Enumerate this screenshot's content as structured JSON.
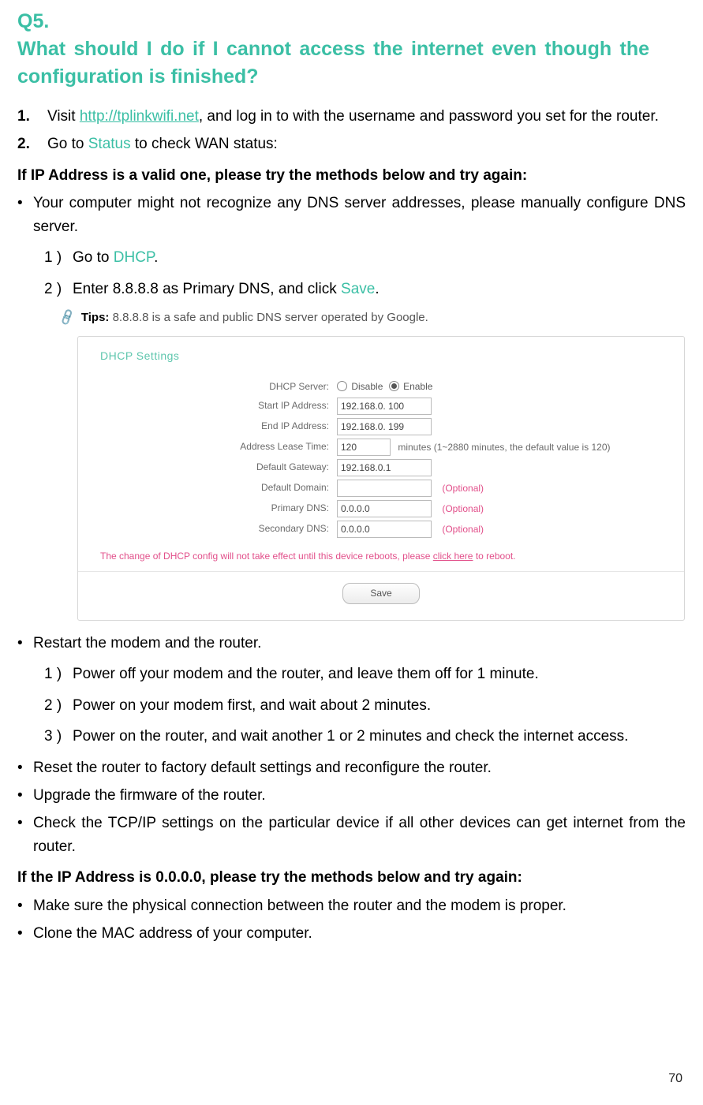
{
  "pageNumber": "70",
  "question": {
    "label": "Q5.",
    "text": "What should I do if I cannot access the internet even though the configuration is finished?"
  },
  "steps": {
    "s1": {
      "marker": "1.",
      "prefix": "Visit ",
      "link": "http://tplinkwifi.net",
      "suffix": ", and log in to with the username and password you set for the router."
    },
    "s2": {
      "marker": "2.",
      "prefix": "Go to ",
      "green": "Status",
      "suffix": " to check WAN status:"
    }
  },
  "validIpHeader": "If IP Address is a valid one, please try the methods below and try again:",
  "bullets1": {
    "b1": "Your computer might not recognize any DNS server addresses, please manually configure DNS server."
  },
  "sub1": {
    "n1": {
      "marker": "1 )",
      "prefix": "Go to ",
      "green": "DHCP",
      "suffix": "."
    },
    "n2": {
      "marker": "2 )",
      "prefix": "Enter 8.8.8.8 as Primary DNS, and click ",
      "green": "Save",
      "suffix": "."
    }
  },
  "tips": {
    "label": "Tips:",
    "text": " 8.8.8.8 is a safe and public DNS server operated by Google."
  },
  "figure": {
    "title": "DHCP Settings",
    "rows": {
      "server": {
        "label": "DHCP Server:",
        "optDisable": "Disable",
        "optEnable": "Enable"
      },
      "start": {
        "label": "Start IP Address:",
        "value": "192.168.0. 100"
      },
      "end": {
        "label": "End IP Address:",
        "value": "192.168.0. 199"
      },
      "lease": {
        "label": "Address Lease Time:",
        "value": "120",
        "suffix": "minutes (1~2880 minutes, the default value is 120)"
      },
      "gateway": {
        "label": "Default Gateway:",
        "value": "192.168.0.1"
      },
      "domain": {
        "label": "Default Domain:",
        "value": "",
        "optional": "(Optional)"
      },
      "pdns": {
        "label": "Primary DNS:",
        "value": "0.0.0.0",
        "optional": "(Optional)"
      },
      "sdns": {
        "label": "Secondary DNS:",
        "value": "0.0.0.0",
        "optional": "(Optional)"
      }
    },
    "warn": {
      "prefix": "The change of DHCP config will not take effect until this device reboots, please ",
      "link": "click here",
      "suffix": " to reboot."
    },
    "save": "Save"
  },
  "bullets2": {
    "b1": "Restart the modem and the router."
  },
  "sub2": {
    "n1": {
      "marker": "1 )",
      "text": "Power off your modem and the router, and leave them off for 1 minute."
    },
    "n2": {
      "marker": "2 )",
      "text": "Power on your modem first, and wait about 2 minutes."
    },
    "n3": {
      "marker": "3 )",
      "text": "Power on the router, and wait another 1 or 2 minutes and check the internet access."
    }
  },
  "bullets3": {
    "b1": "Reset the router to factory default settings and reconfigure the router.",
    "b2": "Upgrade the firmware of the router.",
    "b3": "Check the TCP/IP settings on the particular device if all other devices can get internet from the router."
  },
  "zeroIpHeader": "If the IP Address is 0.0.0.0, please try the methods below and try again:",
  "bullets4": {
    "b1": "Make sure the physical connection between the router and the modem is proper.",
    "b2": "Clone the MAC address of your computer."
  }
}
